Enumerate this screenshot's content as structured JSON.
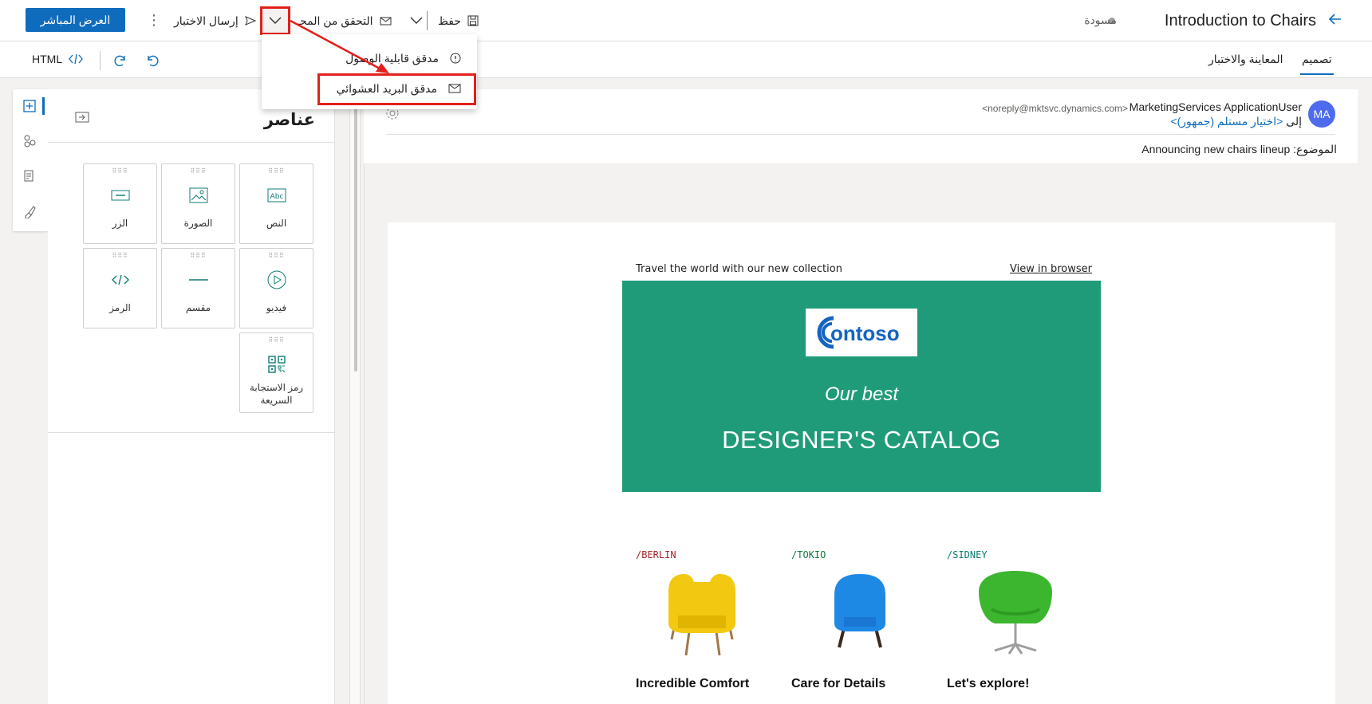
{
  "header": {
    "title": "Introduction to Chairs",
    "status": "مسودة",
    "primary_button": "العرض المباشر",
    "save_label": "حفظ",
    "check_label": "التحقق من المحـ",
    "send_test_label": "إرسال الاختبار"
  },
  "tabs": {
    "design": "تصميم",
    "preview": "المعاينة والاختبار",
    "html": "HTML"
  },
  "dropdown": {
    "items": [
      {
        "label": "مدقق قابلية الوصول",
        "icon": "info-icon"
      },
      {
        "label": "مدقق البريد العشوائي",
        "icon": "mail-icon"
      }
    ]
  },
  "panel": {
    "title": "عناصر",
    "tiles": [
      {
        "label": "النص",
        "icon": "text-icon"
      },
      {
        "label": "الصورة",
        "icon": "image-icon"
      },
      {
        "label": "الزر",
        "icon": "button-icon"
      },
      {
        "label": "فيديو",
        "icon": "video-icon"
      },
      {
        "label": "مقسم",
        "icon": "divider-icon"
      },
      {
        "label": "الرمز",
        "icon": "code-icon"
      },
      {
        "label": "رمز الاستجابة السريعة",
        "icon": "qr-code-icon"
      }
    ]
  },
  "email": {
    "avatar_initials": "MA",
    "from_name": "MarketingServices ApplicationUser",
    "from_address": "<noreply@mktsvc.dynamics.com>",
    "to_label": "إلى",
    "to_value": "<اختيار مستلم (جمهور)>",
    "subject_label": "الموضوع:",
    "subject_value": "Announcing new chairs lineup",
    "preheader": "Travel the world with our new collection",
    "view_in_browser": "View in browser",
    "logo_text": "ontoso",
    "hero_subtitle": "Our best",
    "hero_title": "DESIGNER'S CATALOG",
    "products": [
      {
        "tag": "/BERLIN",
        "name": "Incredible Comfort",
        "tag_color": "#a4262c",
        "chair_color": "#f2c811"
      },
      {
        "tag": "/TOKIO",
        "name": "Care for Details",
        "tag_color": "#107c41",
        "chair_color": "#1e88e5"
      },
      {
        "tag": "/SIDNEY",
        "name": "Let's explore!",
        "tag_color": "#0e7c74",
        "chair_color": "#3cb62e"
      }
    ]
  },
  "colors": {
    "accent": "#0f6cbd",
    "hero_bg": "#209b79",
    "annotation": "#e3201b"
  }
}
